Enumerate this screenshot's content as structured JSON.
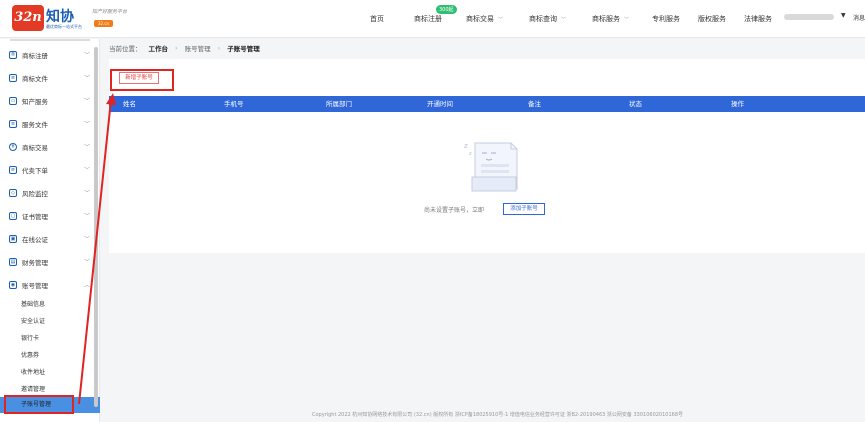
{
  "header": {
    "logo_badge": "32n",
    "logo_text": "知协",
    "logo_sub": "最优商标一站式平台",
    "logo_slogan": "知产好服务平台",
    "logo_tag": "32.cn",
    "nav": [
      {
        "label": "首页",
        "chevron": false
      },
      {
        "label": "商标注册",
        "chevron": false,
        "badge": "300起"
      },
      {
        "label": "商标交易",
        "chevron": true
      },
      {
        "label": "商标查询",
        "chevron": true
      },
      {
        "label": "商标服务",
        "chevron": true
      },
      {
        "label": "专利服务",
        "chevron": false
      },
      {
        "label": "版权服务",
        "chevron": false
      },
      {
        "label": "法律服务",
        "chevron": false
      }
    ],
    "user_caret": "▼",
    "user_extra": "消息"
  },
  "sidebar": {
    "items": [
      {
        "label": "商标注册"
      },
      {
        "label": "商标文件"
      },
      {
        "label": "知产服务"
      },
      {
        "label": "服务文件"
      },
      {
        "label": "商标交易"
      },
      {
        "label": "代卖下单"
      },
      {
        "label": "风险监控"
      },
      {
        "label": "证书管理"
      },
      {
        "label": "在线公证"
      },
      {
        "label": "财务管理"
      },
      {
        "label": "账号管理",
        "expanded": true
      }
    ],
    "sub_items": [
      {
        "label": "基础信息"
      },
      {
        "label": "安全认证"
      },
      {
        "label": "银行卡"
      },
      {
        "label": "优惠券"
      },
      {
        "label": "收件地址"
      },
      {
        "label": "邀请管理"
      },
      {
        "label": "子账号管理",
        "active": true
      }
    ]
  },
  "breadcrumb": {
    "prefix": "当前位置：",
    "level1": "工作台",
    "level2": "账号管理",
    "level3": "子账号管理"
  },
  "main": {
    "add_button": "新增子账号",
    "columns": [
      "姓名",
      "手机号",
      "所属部门",
      "开通时间",
      "备注",
      "状态",
      "操作"
    ],
    "empty_text": "尚未设置子账号，立即",
    "empty_button": "添加子账号"
  },
  "footer": {
    "text": "Copyright 2022 杭州知协网络技术有限公司 (32.cn) 版权所有   浙ICP备18025910号-1 增值电信业务经营许可证 浙B2-20190463   浙公网安备 33010602010168号"
  },
  "colors": {
    "accent": "#2f67d8",
    "annotation": "#e02424",
    "active_sub": "#4a90e2"
  }
}
